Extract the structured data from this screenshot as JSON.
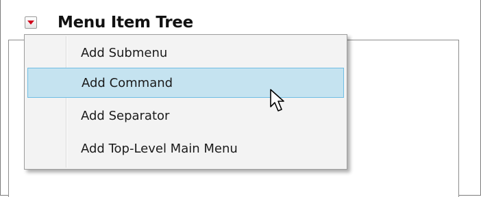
{
  "panel": {
    "title": "Menu Item Tree",
    "toggle_icon": "red-triangle-menu-icon"
  },
  "context_menu": {
    "items": [
      {
        "label": "Add Submenu"
      },
      {
        "label": "Add Command",
        "highlighted": true
      },
      {
        "label": "Add Separator"
      },
      {
        "label": "Add Top-Level Main Menu"
      }
    ],
    "highlight_color": "#c5e3f0",
    "highlight_border_color": "#6fbde3"
  },
  "cursor_icon": "mouse-pointer-icon"
}
